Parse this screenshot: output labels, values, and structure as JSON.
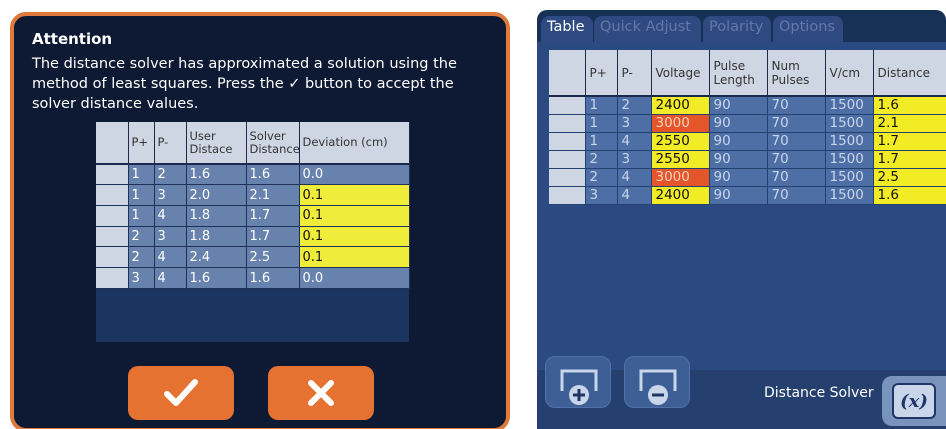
{
  "dialog": {
    "title": "Attention",
    "message": "The distance solver has approximated a solution using the method of least squares.  Press the ✓ button to accept the solver distance values.",
    "table": {
      "headers": [
        "",
        "P+",
        "P-",
        "User Distace",
        "Solver Distance",
        "Deviation (cm)"
      ],
      "rows": [
        {
          "p_plus": "1",
          "p_minus": "2",
          "user_distance": "1.6",
          "solver_distance": "1.6",
          "deviation": "0.0",
          "highlight": false
        },
        {
          "p_plus": "1",
          "p_minus": "3",
          "user_distance": "2.0",
          "solver_distance": "2.1",
          "deviation": "0.1",
          "highlight": true
        },
        {
          "p_plus": "1",
          "p_minus": "4",
          "user_distance": "1.8",
          "solver_distance": "1.7",
          "deviation": "0.1",
          "highlight": true
        },
        {
          "p_plus": "2",
          "p_minus": "3",
          "user_distance": "1.8",
          "solver_distance": "1.7",
          "deviation": "0.1",
          "highlight": true
        },
        {
          "p_plus": "2",
          "p_minus": "4",
          "user_distance": "2.4",
          "solver_distance": "2.5",
          "deviation": "0.1",
          "highlight": true
        },
        {
          "p_plus": "3",
          "p_minus": "4",
          "user_distance": "1.6",
          "solver_distance": "1.6",
          "deviation": "0.0",
          "highlight": false
        }
      ]
    },
    "accept_icon": "checkmark-icon",
    "cancel_icon": "close-icon"
  },
  "panel": {
    "tabs": [
      {
        "label": "Table",
        "active": true
      },
      {
        "label": "Quick Adjust",
        "active": false
      },
      {
        "label": "Polarity",
        "active": false
      },
      {
        "label": "Options",
        "active": false
      }
    ],
    "table": {
      "headers": [
        "",
        "P+",
        "P-",
        "Voltage",
        "Pulse Length",
        "Num Pulses",
        "V/cm",
        "Distance"
      ],
      "rows": [
        {
          "p_plus": "1",
          "p_minus": "2",
          "voltage": "2400",
          "voltage_color": "yellow",
          "pulse_length": "90",
          "num_pulses": "70",
          "v_cm": "1500",
          "distance": "1.6"
        },
        {
          "p_plus": "1",
          "p_minus": "3",
          "voltage": "3000",
          "voltage_color": "orange",
          "pulse_length": "90",
          "num_pulses": "70",
          "v_cm": "1500",
          "distance": "2.1"
        },
        {
          "p_plus": "1",
          "p_minus": "4",
          "voltage": "2550",
          "voltage_color": "yellow",
          "pulse_length": "90",
          "num_pulses": "70",
          "v_cm": "1500",
          "distance": "1.7"
        },
        {
          "p_plus": "2",
          "p_minus": "3",
          "voltage": "2550",
          "voltage_color": "yellow",
          "pulse_length": "90",
          "num_pulses": "70",
          "v_cm": "1500",
          "distance": "1.7"
        },
        {
          "p_plus": "2",
          "p_minus": "4",
          "voltage": "3000",
          "voltage_color": "orange",
          "pulse_length": "90",
          "num_pulses": "70",
          "v_cm": "1500",
          "distance": "2.5"
        },
        {
          "p_plus": "3",
          "p_minus": "4",
          "voltage": "2400",
          "voltage_color": "yellow",
          "pulse_length": "90",
          "num_pulses": "70",
          "v_cm": "1500",
          "distance": "1.6"
        }
      ]
    },
    "add_icon": "add-row-icon",
    "remove_icon": "remove-row-icon",
    "solver_label": "Distance Solver",
    "solver_icon_text": "(x)"
  },
  "colors": {
    "accent_orange": "#e67231",
    "highlight_yellow": "#f2ec27",
    "warning_orange": "#e5552a",
    "dialog_bg": "#0e1933",
    "panel_bg": "#2c4a82"
  }
}
